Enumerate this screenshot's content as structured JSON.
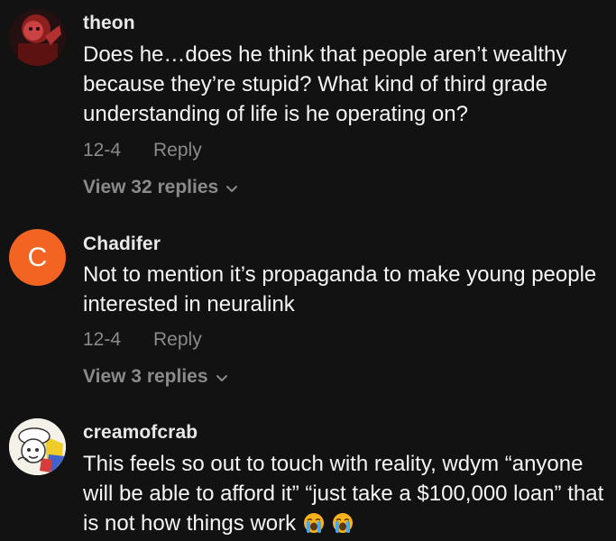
{
  "comments": [
    {
      "username": "theon",
      "avatar_icon": "profile-photo",
      "text": "Does he…does he think that people aren’t wealthy because they’re stupid? What kind of third grade understanding of life is he operating on?",
      "date": "12-4",
      "reply_label": "Reply",
      "view_replies": "View 32 replies"
    },
    {
      "username": "Chadifer",
      "avatar_letter": "C",
      "avatar_color": "#f36321",
      "text": "Not to mention it’s propaganda to make young people interested in neuralink",
      "date": "12-4",
      "reply_label": "Reply",
      "view_replies": "View 3 replies"
    },
    {
      "username": "creamofcrab",
      "avatar_icon": "cartoon-profile-photo",
      "text": "This feels so out to touch with reality, wdym “anyone will be able to afford it” “just take a $100,000 loan” that is not how things work",
      "emojis": [
        "loudly-crying-face",
        "loudly-crying-face"
      ]
    }
  ]
}
